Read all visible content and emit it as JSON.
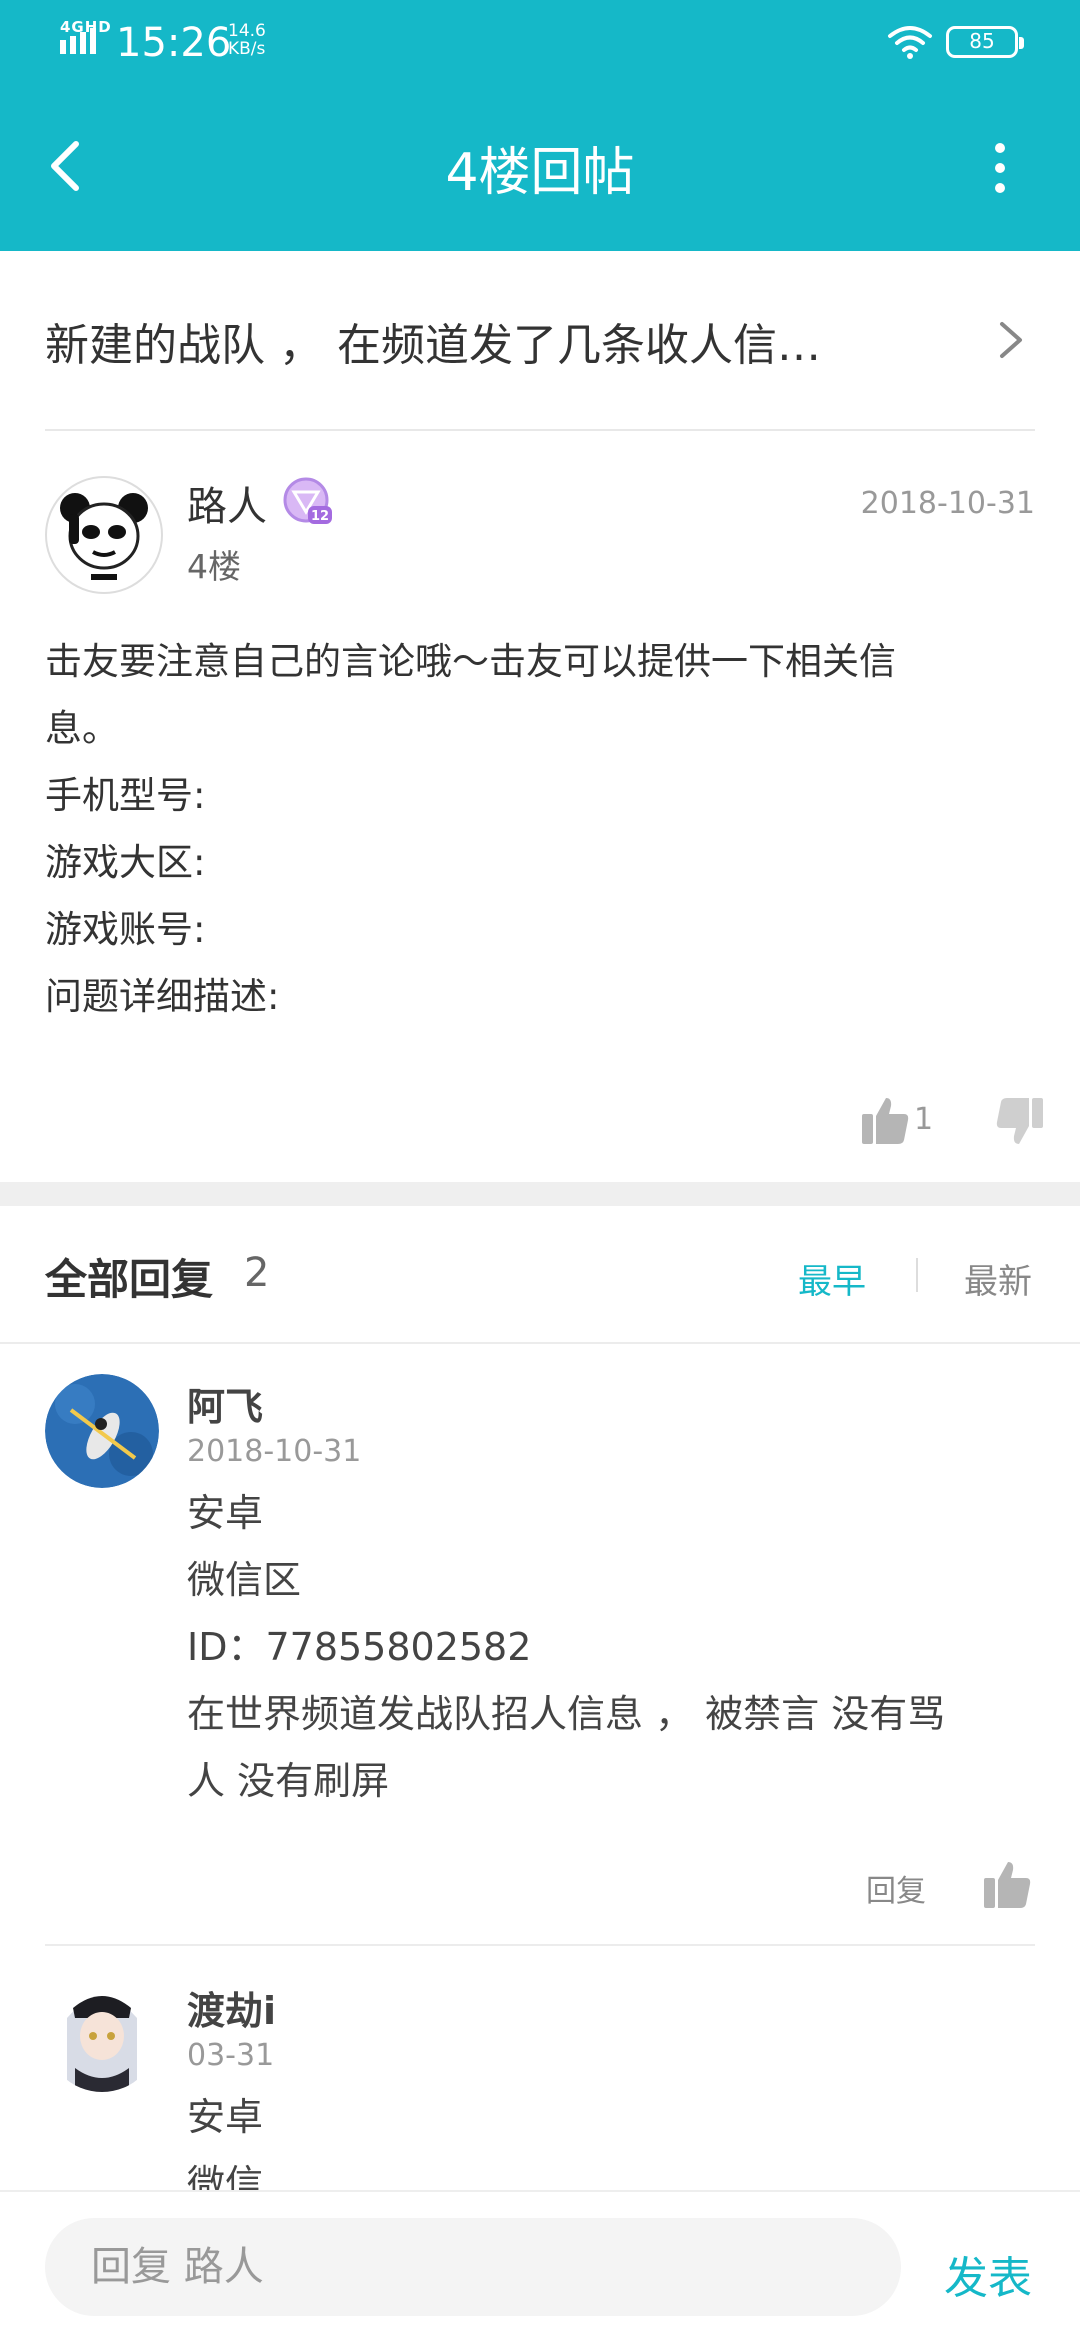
{
  "status_bar": {
    "network": "4GHD",
    "time": "15:26",
    "speed_value": "14.6",
    "speed_unit": "KB/s",
    "battery": "85"
  },
  "header": {
    "title": "4楼回帖",
    "back_icon": "chevron-left-icon",
    "more_icon": "more-vertical-icon"
  },
  "thread": {
    "title": "新建的战队 ， 在频道发了几条收人信…"
  },
  "post": {
    "author": "路人",
    "level_badge": "12",
    "floor": "4楼",
    "date": "2018-10-31",
    "body": [
      "击友要注意自己的言论哦～击友可以提供一下相关信",
      "息。",
      "手机型号:",
      "游戏大区:",
      "游戏账号:",
      "问题详细描述:"
    ],
    "like_count": "1"
  },
  "replies": {
    "label": "全部回复",
    "count": "2",
    "sort_earliest": "最早",
    "sort_latest": "最新",
    "items": [
      {
        "name": "阿飞",
        "date": "2018-10-31",
        "lines": [
          "安卓",
          "微信区",
          "ID：77855802582",
          "在世界频道发战队招人信息 ， 被禁言  没有骂",
          "人  没有刷屏"
        ],
        "reply_label": "回复"
      },
      {
        "name": "渡劫i",
        "date": "03-31",
        "lines": [
          "安卓",
          "微信"
        ]
      }
    ]
  },
  "compose": {
    "placeholder": "回复 路人",
    "send_label": "发表"
  },
  "colors": {
    "accent": "#15b8c8",
    "text": "#333333",
    "muted": "#999999"
  }
}
